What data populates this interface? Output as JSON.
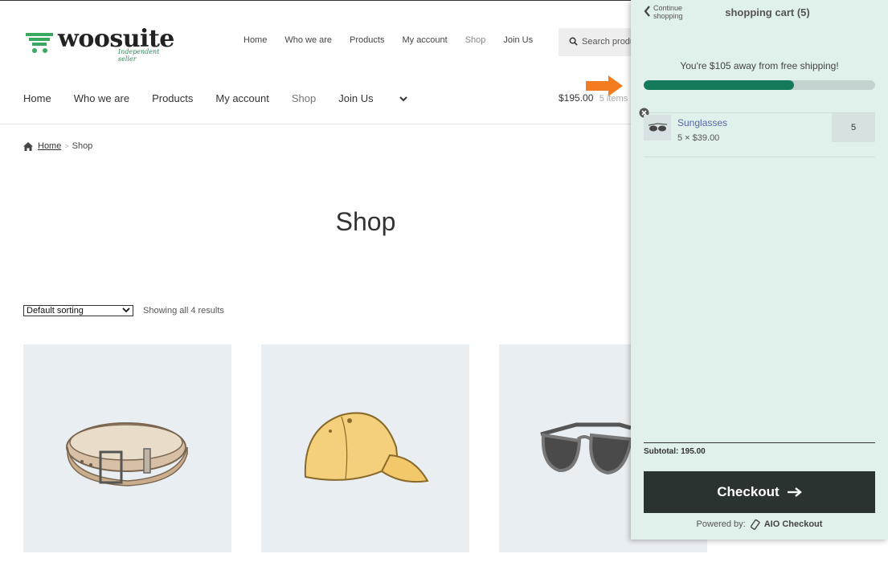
{
  "brand": {
    "name": "woosuite",
    "tagline": "Independent seller"
  },
  "nav_top": [
    {
      "label": "Home"
    },
    {
      "label": "Who we are"
    },
    {
      "label": "Products"
    },
    {
      "label": "My account"
    },
    {
      "label": "Shop"
    },
    {
      "label": "Join Us"
    }
  ],
  "search": {
    "text": "Search products…"
  },
  "nav_main": [
    {
      "label": "Home"
    },
    {
      "label": "Who we are"
    },
    {
      "label": "Products"
    },
    {
      "label": "My account"
    },
    {
      "label": "Shop"
    },
    {
      "label": "Join Us"
    }
  ],
  "mini_cart": {
    "total": "$195.00",
    "count": "5 items"
  },
  "breadcrumb": {
    "home": "Home",
    "current": "Shop"
  },
  "page_title": "Shop",
  "sorting": {
    "selected": "Default sorting"
  },
  "results_text": "Showing all 4 results",
  "products": [
    {
      "name": "Belt",
      "icon": "belt-image"
    },
    {
      "name": "Cap",
      "icon": "cap-image"
    },
    {
      "name": "Sunglasses",
      "icon": "sunglasses-image"
    }
  ],
  "cart": {
    "continue_label": "Continue shopping",
    "title": "shopping cart (5)",
    "shipping_message": "You're $105 away from free shipping!",
    "shipping_progress": 0.65,
    "items": [
      {
        "name": "Sunglasses",
        "qty_price": "5 × $39.00",
        "qty": "5"
      }
    ],
    "subtotal": "Subtotal: 195.00",
    "checkout_label": "Checkout",
    "powered_by": "Powered by:",
    "powered_name": "AIO Checkout"
  },
  "colors": {
    "accent": "#157a5c",
    "drawer_bg": "#e0f0ea",
    "checkout_bg": "#2a3330",
    "annotation_arrow": "#f47c20"
  }
}
